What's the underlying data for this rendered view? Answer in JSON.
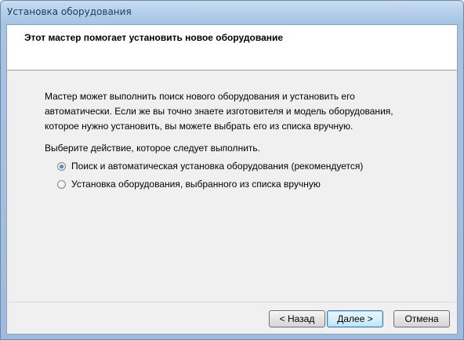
{
  "window": {
    "title": "Установка оборудования"
  },
  "header": {
    "title": "Этот мастер помогает установить новое оборудование"
  },
  "body": {
    "description": "Мастер может выполнить поиск нового оборудования и установить его автоматически. Если же вы точно знаете изготовителя и модель оборудования, которое нужно установить, вы можете выбрать его из списка вручную.",
    "prompt": "Выберите действие, которое следует выполнить."
  },
  "options": [
    {
      "label": "Поиск и автоматическая установка оборудования (рекомендуется)",
      "checked": true
    },
    {
      "label": "Установка оборудования, выбранного из списка вручную",
      "checked": false
    }
  ],
  "buttons": {
    "back": "< Назад",
    "next": "Далее >",
    "cancel": "Отмена"
  }
}
